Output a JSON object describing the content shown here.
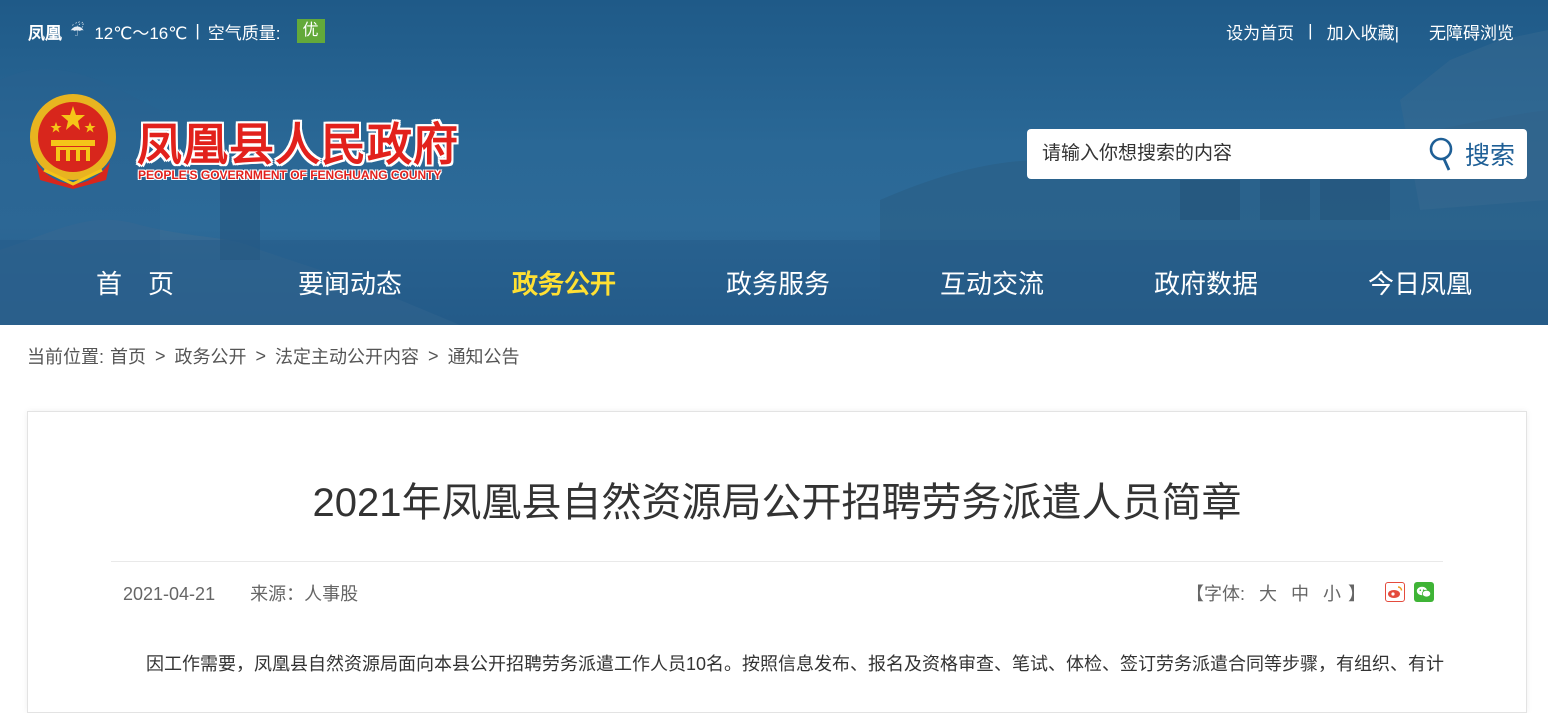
{
  "topbar": {
    "city": "凤凰",
    "weather_icon": "cloud-rain-icon",
    "temperature": "12℃～16℃",
    "separator": "|",
    "air_quality_label": "空气质量:",
    "air_quality_value": "优",
    "air_quality_color": "#63a93a"
  },
  "toplinks": {
    "set_home": "设为首页",
    "divider": "|",
    "add_favorite": "加入收藏|",
    "accessibility": "无障碍浏览"
  },
  "site": {
    "name": "凤凰县人民政府",
    "name_en": "PEOPLE'S GOVERNMENT OF FENGHUANG COUNTY",
    "brand_red": "#e2211c"
  },
  "search": {
    "placeholder": "请输入你想搜索的内容",
    "button_label": "搜索"
  },
  "nav": {
    "items": [
      {
        "label": "首　页"
      },
      {
        "label": "要闻动态"
      },
      {
        "label": "政务公开"
      },
      {
        "label": "政务服务"
      },
      {
        "label": "互动交流"
      },
      {
        "label": "政府数据"
      },
      {
        "label": "今日凤凰"
      }
    ],
    "active_index": 2,
    "active_color": "#ffe033"
  },
  "breadcrumb": {
    "prefix": "当前位置:",
    "items": [
      "首页",
      "政务公开",
      "法定主动公开内容",
      "通知公告"
    ],
    "separator": ">"
  },
  "article": {
    "title": "2021年凤凰县自然资源局公开招聘劳务派遣人员简章",
    "date": "2021-04-21",
    "source": "来源：人事股",
    "font_size_open": "【字体:",
    "font_large": "大",
    "font_medium": "中",
    "font_small": "小",
    "font_size_close": "】",
    "share_icons": [
      "weibo-icon",
      "wechat-icon"
    ],
    "body_first_line": "因工作需要，凤凰县自然资源局面向本县公开招聘劳务派遣工作人员10名。按照信息发布、报名及资格审查、笔试、体检、签订劳务派遣合同等步骤，有组织、有计"
  }
}
